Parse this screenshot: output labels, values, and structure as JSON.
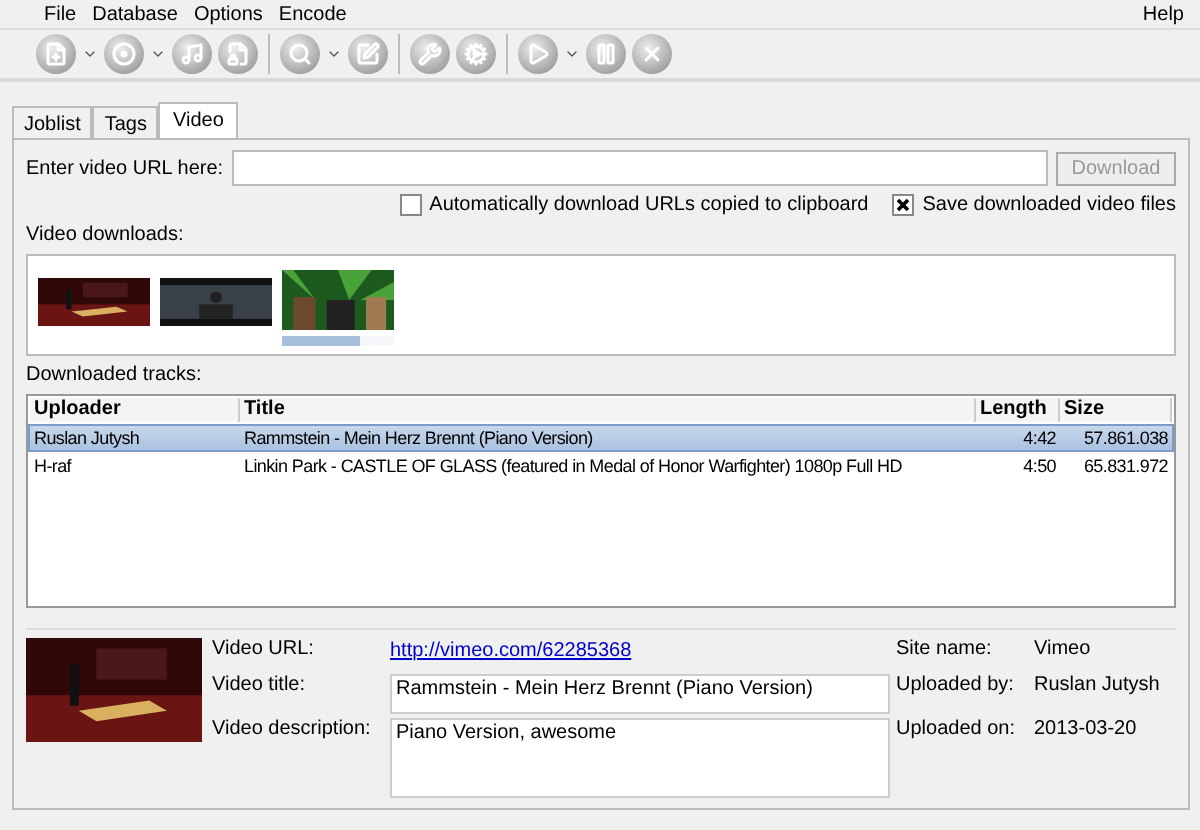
{
  "menu": [
    "File",
    "Database",
    "Options",
    "Encode"
  ],
  "help_menu": "Help",
  "tabs": [
    {
      "label": "Joblist",
      "selected": false
    },
    {
      "label": "Tags",
      "selected": false
    },
    {
      "label": "Video",
      "selected": true
    }
  ],
  "url_label": "Enter video URL here:",
  "download_button": {
    "label": "Download",
    "disabled": true
  },
  "options": [
    {
      "label": "Automatically download URLs copied to clipboard",
      "checked": false
    },
    {
      "label": "Save downloaded video files",
      "checked": true
    }
  ],
  "downloads_label": "Video downloads:",
  "downloads": [
    {
      "kind": "picture"
    },
    {
      "kind": "picture"
    },
    {
      "kind": "picture",
      "level": 0.7
    }
  ],
  "tracks_label": "Downloaded tracks:",
  "table": {
    "columns": [
      "Uploader",
      "Title",
      "Length",
      "Size"
    ],
    "rows": [
      {
        "cells": [
          "Ruslan Jutysh",
          "Rammstein - Mein Herz Brennt (Piano Version)",
          "4:42",
          "57.861.038"
        ],
        "selected": true
      },
      {
        "cells": [
          "H-raf",
          "Linkin Park - CASTLE OF GLASS (featured in Medal of Honor Warfighter) 1080p Full HD",
          "4:50",
          "65.831.972"
        ],
        "selected": false
      }
    ]
  },
  "details": {
    "url_label": "Video URL:",
    "url": "http://vimeo.com/62285368",
    "title_label": "Video title:",
    "title": "Rammstein - Mein Herz Brennt (Piano Version)",
    "description_label": "Video description:",
    "description": "Piano Version, awesome",
    "site_label": "Site name:",
    "site": "Vimeo",
    "uploader_label": "Uploaded by:",
    "uploader": "Ruslan Jutysh",
    "date_label": "Uploaded on:",
    "date": "2013-03-20"
  }
}
